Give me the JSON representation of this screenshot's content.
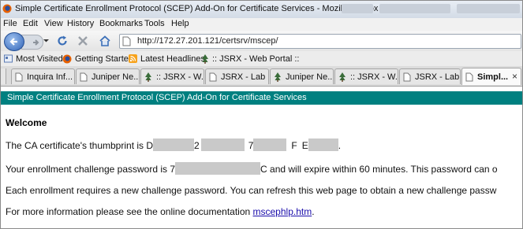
{
  "window": {
    "title": "Simple Certificate Enrollment Protocol (SCEP) Add-On for Certificate Services - Mozilla Firefox"
  },
  "menu": {
    "items": [
      "File",
      "Edit",
      "View",
      "History",
      "Bookmarks",
      "Tools",
      "Help"
    ]
  },
  "nav": {
    "url": "http://172.27.201.121/certsrv/mscep/"
  },
  "bookmarks": {
    "items": [
      "Most Visited",
      "Getting Started",
      "Latest Headlines",
      ":: JSRX - Web Portal ::"
    ]
  },
  "tabs": {
    "items": [
      "Inquira Inf...",
      "Juniper Ne...",
      ":: JSRX - W...",
      "JSRX - Lab ...",
      "Juniper Ne...",
      ":: JSRX - W...",
      "JSRX - Lab ...",
      "Simpl..."
    ],
    "close": "×"
  },
  "page": {
    "header": "Simple Certificate Enrollment Protocol (SCEP) Add-On for Certificate Services",
    "welcome": "Welcome",
    "thumb_prefix": "The CA certificate's thumbprint is D",
    "thumb_p1": "2",
    "thumb_p2": "7",
    "thumb_p3": "F",
    "thumb_p4": "E",
    "thumb_end": ".",
    "pw_prefix": "Your enrollment challenge password is 7",
    "pw_suffix": "C and will expire within 60 minutes.   This password can o",
    "each_line": "Each enrollment requires a new challenge password.   You can refresh this web page to obtain a new challenge passw",
    "more_prefix": "For more information please see the online documentation ",
    "more_link": "mscephlp.htm",
    "more_end": "."
  },
  "colors": {
    "header_band": "#008080",
    "link": "#1a0dab",
    "redaction": "#c9c9c9"
  }
}
